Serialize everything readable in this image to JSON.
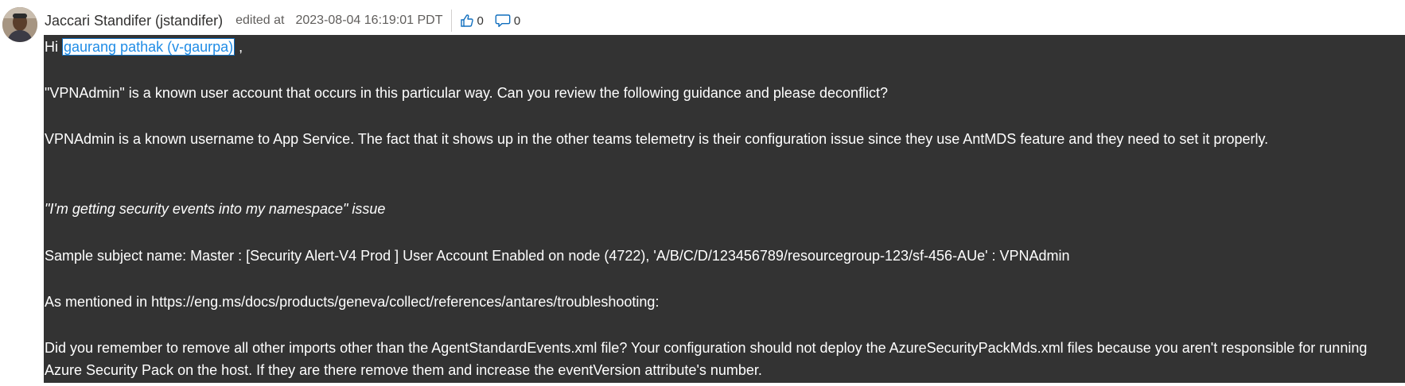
{
  "comment": {
    "author": "Jaccari Standifer (jstandifer)",
    "edited_label": "edited at",
    "edited_time": "2023-08-04 16:19:01 PDT",
    "likes": "0",
    "replies": "0"
  },
  "body": {
    "greeting_prefix": "Hi ",
    "mention": "gaurang pathak (v-gaurpa)",
    "greeting_suffix": " ,",
    "p1": "\"VPNAdmin\" is a known user account that occurs in this particular way. Can you review the following guidance and please deconflict?",
    "p2": "VPNAdmin is a known username to App Service. The fact that it shows up in the other teams telemetry is their configuration issue since they use AntMDS feature and they need to set it properly.",
    "p3": "\"I'm getting security events into my namespace\" issue",
    "p4": "Sample subject name: Master : [Security Alert-V4 Prod ] User Account Enabled on node (4722), 'A/B/C/D/123456789/resourcegroup-123/sf-456-AUe' : VPNAdmin",
    "p5": "As mentioned in https://eng.ms/docs/products/geneva/collect/references/antares/troubleshooting:",
    "p6": "Did you remember to remove all other imports other than the AgentStandardEvents.xml file? Your configuration should not deploy the AzureSecurityPackMds.xml files because you aren't responsible for running Azure Security Pack on the host. If they are there remove them and increase the eventVersion attribute's number."
  },
  "icons": {
    "like": "thumbs-up-icon",
    "reply": "reply-bubble-icon",
    "avatar": "user-avatar"
  },
  "colors": {
    "body_background": "#333333",
    "mention_link": "#1f8ce6",
    "reaction_icon": "#106ebe"
  }
}
